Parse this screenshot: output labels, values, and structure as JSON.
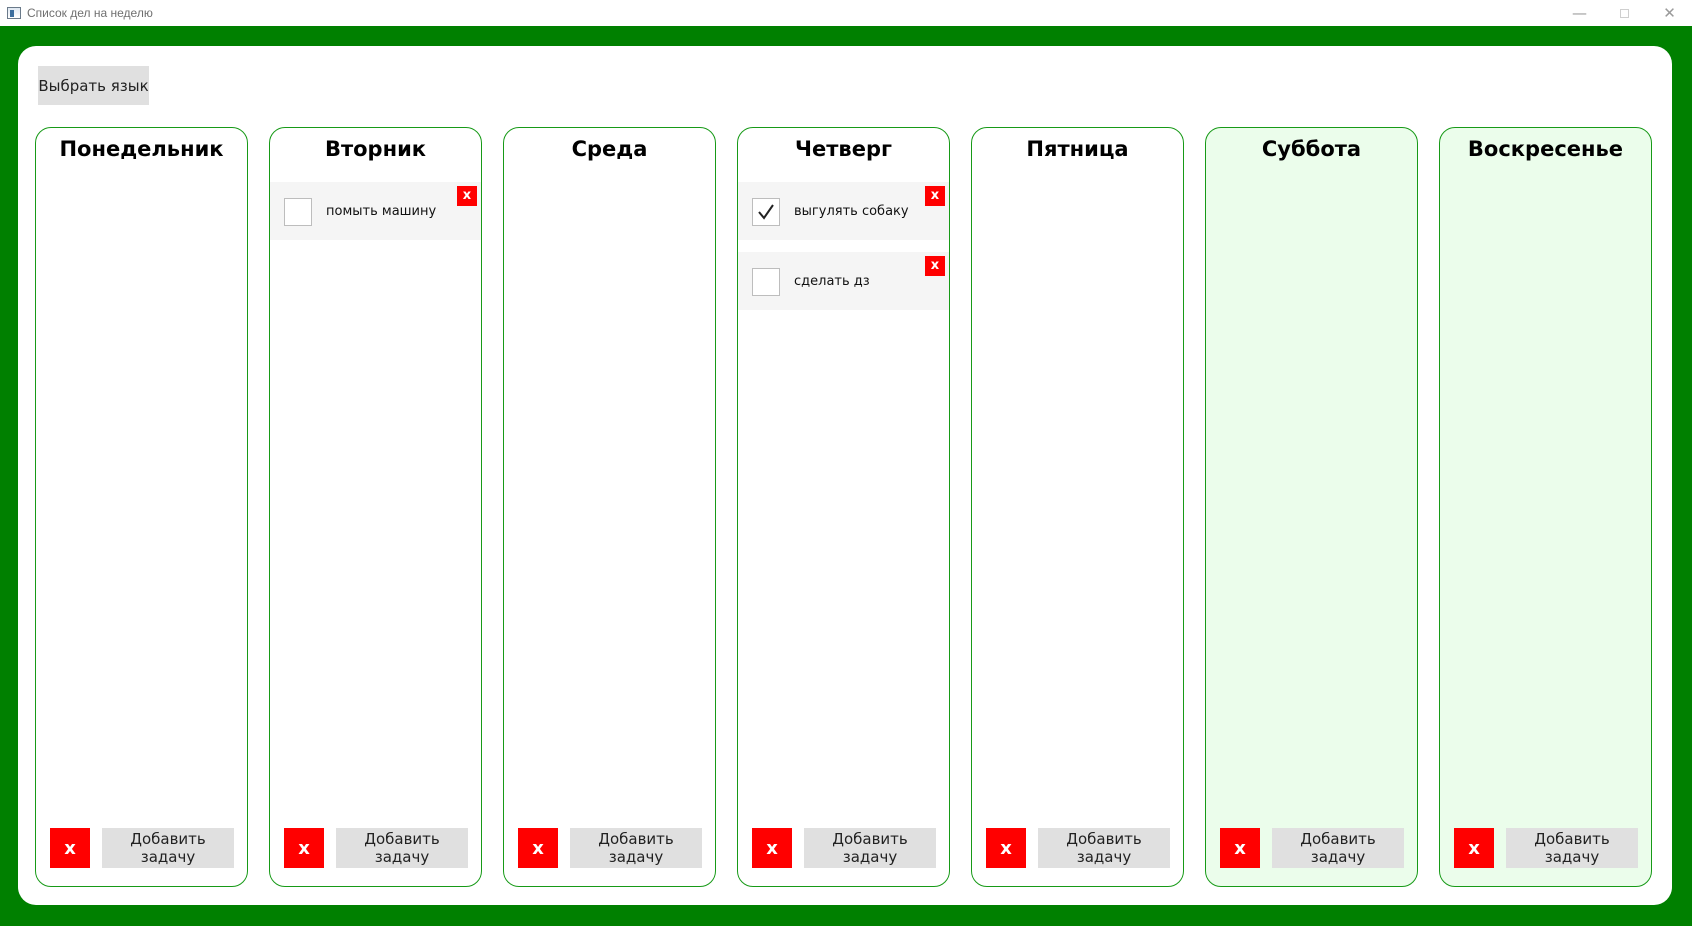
{
  "window": {
    "title": "Список дел на неделю",
    "controls": {
      "minimize": "—",
      "close": "✕"
    }
  },
  "toolbar": {
    "language_button": "Выбрать язык"
  },
  "colors": {
    "frame": "#008000",
    "column_border": "#179a17",
    "weekend_bg": "#ebfdeb",
    "danger": "#ff0000",
    "button_bg": "#e0e0e0"
  },
  "days": [
    {
      "name": "Понедельник",
      "tasks": [],
      "clear_label": "x",
      "add_label": "Добавить задачу"
    },
    {
      "name": "Вторник",
      "tasks": [
        {
          "text": "помыть машину",
          "done": false,
          "delete_label": "x"
        }
      ],
      "clear_label": "x",
      "add_label": "Добавить задачу"
    },
    {
      "name": "Среда",
      "tasks": [],
      "clear_label": "x",
      "add_label": "Добавить задачу"
    },
    {
      "name": "Четверг",
      "tasks": [
        {
          "text": "выгулять собаку",
          "done": true,
          "delete_label": "x"
        },
        {
          "text": "сделать дз",
          "done": false,
          "delete_label": "x"
        }
      ],
      "clear_label": "x",
      "add_label": "Добавить задачу"
    },
    {
      "name": "Пятница",
      "tasks": [],
      "clear_label": "x",
      "add_label": "Добавить задачу"
    },
    {
      "name": "Суббота",
      "tasks": [],
      "clear_label": "x",
      "add_label": "Добавить задачу"
    },
    {
      "name": "Воскресенье",
      "tasks": [],
      "clear_label": "x",
      "add_label": "Добавить задачу"
    }
  ]
}
